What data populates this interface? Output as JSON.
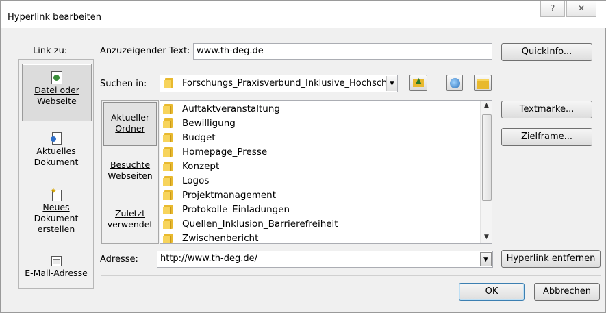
{
  "window": {
    "title": "Hyperlink bearbeiten",
    "help_glyph": "?",
    "close_glyph": "⌧"
  },
  "link_to": {
    "label": "Link zu:",
    "items": [
      {
        "line1": "Datei oder",
        "line2": "Webseite",
        "icon": "file-web-icon",
        "selected": true
      },
      {
        "line1": "Aktuelles",
        "line2": "Dokument",
        "icon": "document-icon",
        "selected": false
      },
      {
        "line1": "Neues",
        "line2": "Dokument",
        "line3": "erstellen",
        "icon": "new-document-icon",
        "selected": false
      },
      {
        "line1": "E-Mail-Adresse",
        "icon": "email-icon",
        "selected": false
      }
    ]
  },
  "display_text": {
    "label": "Anzuzeigender Text:",
    "value": "www.th-deg.de"
  },
  "quickinfo_button": "QuickInfo...",
  "look_in": {
    "label": "Suchen in:",
    "value": "Forschungs_Praxisverbund_Inklusive_Hochsch"
  },
  "subnav": [
    {
      "line1": "Aktueller",
      "line2": "Ordner",
      "selected": true
    },
    {
      "line1": "Besuchte",
      "line2": "Webseiten",
      "selected": false
    },
    {
      "line1": "Zuletzt",
      "line2": "verwendet",
      "selected": false
    }
  ],
  "folders": [
    "Auftaktveranstaltung",
    "Bewilligung",
    "Budget",
    "Homepage_Presse",
    "Konzept",
    "Logos",
    "Projektmanagement",
    "Protokolle_Einladungen",
    "Quellen_Inklusion_Barrierefreiheit",
    "Zwischenbericht"
  ],
  "bookmark_button": "Textmarke...",
  "target_frame_button": "Zielframe...",
  "address": {
    "label": "Adresse:",
    "value": "http://www.th-deg.de/"
  },
  "remove_link_button": "Hyperlink entfernen",
  "ok_button": "OK",
  "cancel_button": "Abbrechen",
  "colors": {
    "folder": "#f7d45c",
    "folder_dark": "#e8b92e",
    "dialog_bg": "#f0f0f0"
  }
}
